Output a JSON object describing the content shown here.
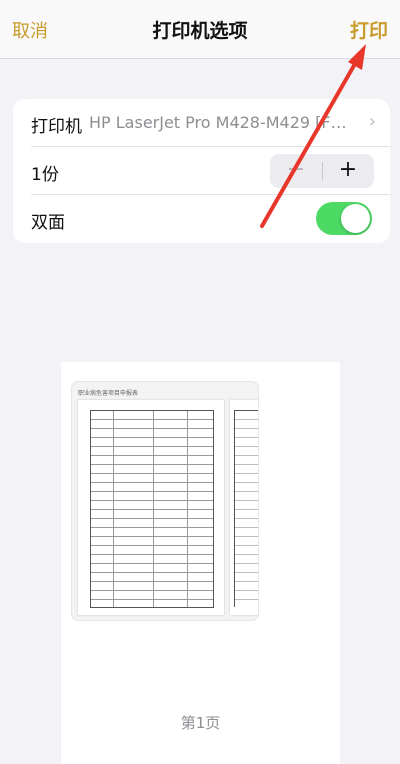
{
  "header": {
    "cancel_label": "取消",
    "title": "打印机选项",
    "print_label": "打印"
  },
  "options": {
    "printer_label": "打印机",
    "printer_name": "HP LaserJet Pro M428-M429 [FF...",
    "copies_label": "1份",
    "minus_symbol": "−",
    "plus_symbol": "+",
    "duplex_label": "双面",
    "duplex_on": true
  },
  "preview": {
    "doc_title": "职业病危害项目申报表",
    "page_label": "第1页"
  },
  "colors": {
    "accent": "#c89b2b",
    "toggle_on": "#4cd964",
    "annotation_arrow": "#e8362a"
  }
}
